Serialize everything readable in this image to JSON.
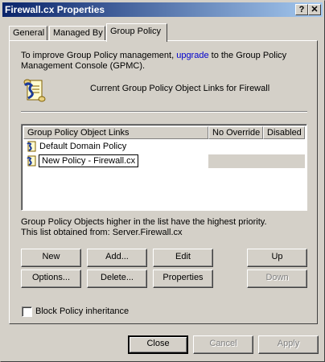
{
  "window": {
    "title": "Firewall.cx Properties",
    "help_label": "?",
    "close_label": "✕"
  },
  "tabs": [
    {
      "label": "General",
      "active": false
    },
    {
      "label": "Managed By",
      "active": false
    },
    {
      "label": "Group Policy",
      "active": true
    }
  ],
  "info": {
    "text_before": "To improve Group Policy management, ",
    "link_text": "upgrade",
    "text_after": " to the Group Policy",
    "line2": "Management Console (GPMC).",
    "current_links_label": "Current Group Policy Object Links for Firewall"
  },
  "list": {
    "columns": [
      "Group Policy Object Links",
      "No Override",
      "Disabled"
    ],
    "rows": [
      {
        "name": "Default Domain Policy",
        "selected": false
      },
      {
        "name": "New Policy - Firewall.cx",
        "selected": true
      }
    ]
  },
  "notes": {
    "priority": "Group Policy Objects higher in the list have the highest priority.",
    "obtained": "This list obtained from: Server.Firewall.cx"
  },
  "buttons": {
    "new": "New",
    "add": "Add...",
    "edit": "Edit",
    "up": "Up",
    "options": "Options...",
    "delete": "Delete...",
    "properties": "Properties",
    "down": "Down"
  },
  "block_inheritance": {
    "label": "Block Policy inheritance",
    "checked": false
  },
  "dialog_buttons": {
    "close": "Close",
    "cancel": "Cancel",
    "apply": "Apply"
  },
  "icons": [
    "gpo-scroll-icon"
  ]
}
